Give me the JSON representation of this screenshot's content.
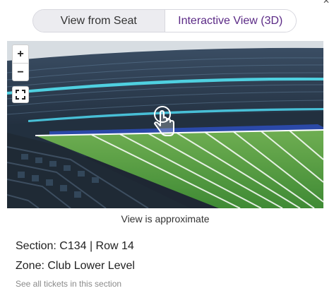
{
  "view_toggle": {
    "options": [
      {
        "label": "View from Seat",
        "selected": false
      },
      {
        "label": "Interactive View (3D)",
        "selected": true
      }
    ]
  },
  "viewer": {
    "zoom_in": "+",
    "zoom_out": "−",
    "fullscreen_icon": "fullscreen-icon",
    "drag_icon": "hand-drag-icon",
    "caption": "View is approximate"
  },
  "seat": {
    "section_row": "Section: C134 | Row 14",
    "zone": "Zone: Club Lower Level",
    "see_all": "See all tickets in this section"
  },
  "colors": {
    "accent": "#5b2a86",
    "field": "#4f9a3f",
    "endzone_wall": "#2b49a8"
  }
}
